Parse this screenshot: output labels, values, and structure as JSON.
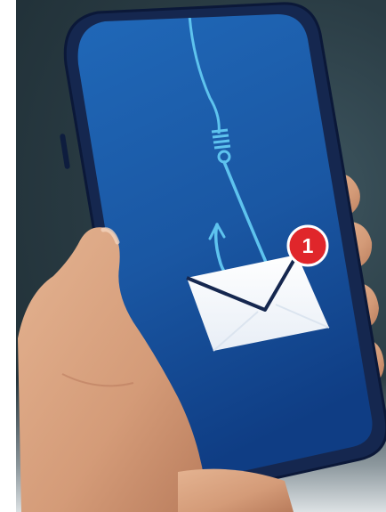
{
  "scene": {
    "description_name": "phishing-phone-photo",
    "notification_count": "1",
    "colors": {
      "screen_top": "#1d5fae",
      "screen_bottom": "#0f3f86",
      "phone_frame": "#15274f",
      "fishing_line": "#5ec3ee",
      "envelope": "#ffffff",
      "badge": "#e0262b",
      "skin": "#d9a583",
      "background": "#2a3c44"
    }
  }
}
